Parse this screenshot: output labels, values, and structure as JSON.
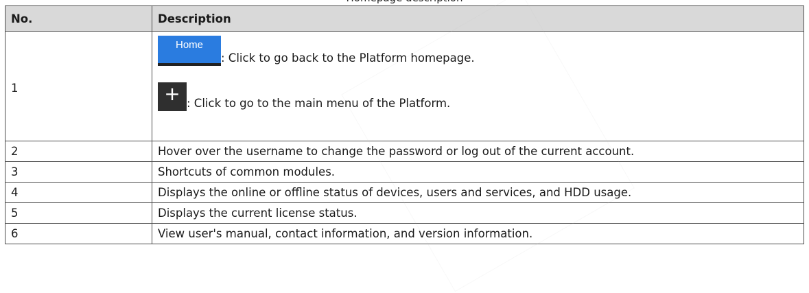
{
  "caption": "Homepage description",
  "table": {
    "headers": [
      "No.",
      "Description"
    ],
    "row1": {
      "number": "1",
      "home_button_label": "Home",
      "home_text": ": Click to go back to the Platform homepage.",
      "plus_icon": "plus-icon",
      "plus_text": ": Click to go to the main menu of the Platform."
    },
    "rows": [
      {
        "number": "2",
        "description": "Hover over the username to change the password or log out of the current account."
      },
      {
        "number": "3",
        "description": "Shortcuts of common modules."
      },
      {
        "number": "4",
        "description": "Displays the online or offline status of devices, users and services, and HDD usage."
      },
      {
        "number": "5",
        "description": "Displays the current license status."
      },
      {
        "number": "6",
        "description": "View user's manual, contact information, and version information."
      }
    ]
  },
  "colors": {
    "header_bg": "#d9d9d9",
    "home_button": "#2a7ce0",
    "plus_button": "#2f2f2f"
  }
}
